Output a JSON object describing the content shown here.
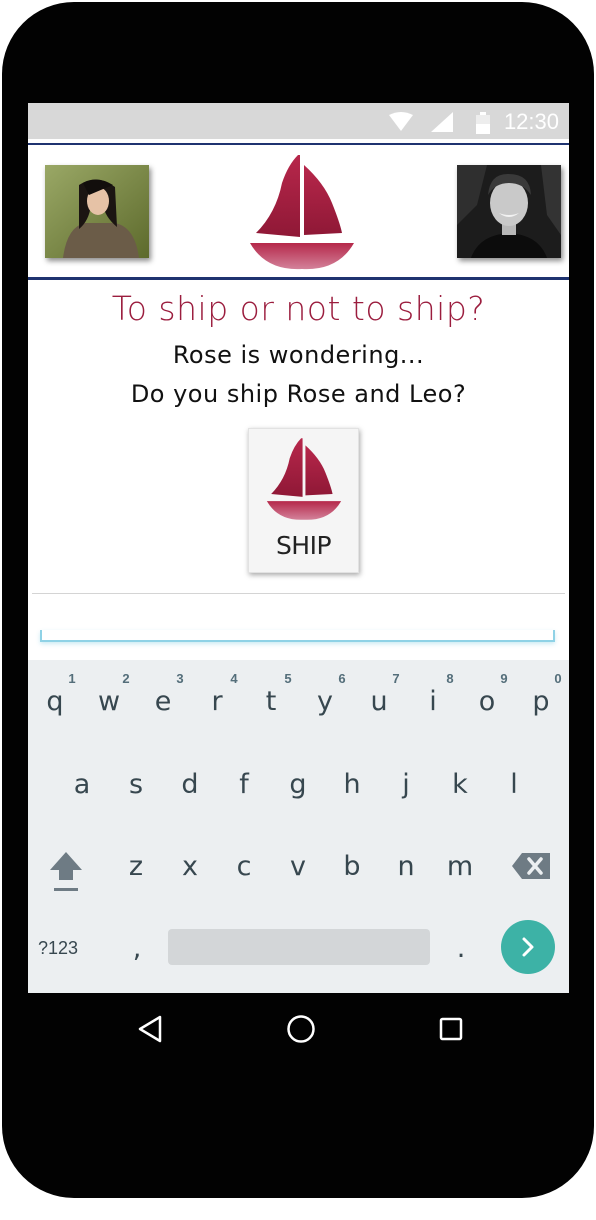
{
  "status_bar": {
    "time": "12:30"
  },
  "header": {
    "avatar_left": "Rose",
    "avatar_right": "Leo"
  },
  "content": {
    "question": "To ship or not to ship?",
    "line1": "Rose is wondering...",
    "line2": "Do you ship Rose and Leo?",
    "ship_button_label": "SHIP"
  },
  "keyboard": {
    "row1": [
      {
        "key": "q",
        "hint": "1"
      },
      {
        "key": "w",
        "hint": "2"
      },
      {
        "key": "e",
        "hint": "3"
      },
      {
        "key": "r",
        "hint": "4"
      },
      {
        "key": "t",
        "hint": "5"
      },
      {
        "key": "y",
        "hint": "6"
      },
      {
        "key": "u",
        "hint": "7"
      },
      {
        "key": "i",
        "hint": "8"
      },
      {
        "key": "o",
        "hint": "9"
      },
      {
        "key": "p",
        "hint": "0"
      }
    ],
    "row2": [
      "a",
      "s",
      "d",
      "f",
      "g",
      "h",
      "j",
      "k",
      "l"
    ],
    "row3": [
      "z",
      "x",
      "c",
      "v",
      "b",
      "n",
      "m"
    ],
    "symbols_label": "?123",
    "comma": ",",
    "period": "."
  },
  "colors": {
    "accent": "#9b1d3e",
    "header_border": "#1f3370",
    "go_button": "#3db2a6"
  },
  "icons": [
    "wifi-icon",
    "signal-icon",
    "battery-icon",
    "sailboat-icon",
    "shift-icon",
    "backspace-icon",
    "enter-arrow-icon",
    "back-nav-icon",
    "home-nav-icon",
    "recents-nav-icon"
  ]
}
